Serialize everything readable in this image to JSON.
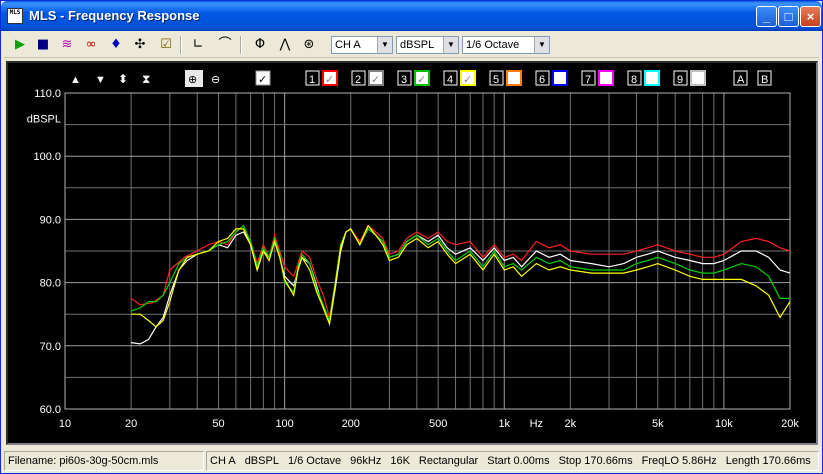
{
  "window": {
    "title": "MLS - Frequency Response",
    "icon_label": "MLS"
  },
  "toolbar": {
    "icons": [
      "run-icon",
      "save-icon",
      "spectrum-icon",
      "infinity-icon",
      "marker-icon",
      "cursor-icon",
      "check-icon",
      "axes-icon",
      "curve-icon",
      "phase-icon",
      "filter-icon",
      "target-icon"
    ],
    "channel": "CH A",
    "unit": "dBSPL",
    "smoothing": "1/6 Octave"
  },
  "plot_toolbar": {
    "overlays": [
      {
        "num": "1",
        "color": "#ff0000",
        "checked": true
      },
      {
        "num": "2",
        "color": "#808080",
        "checked": true
      },
      {
        "num": "3",
        "color": "#00c000",
        "checked": true
      },
      {
        "num": "4",
        "color": "#ffff00",
        "checked": true
      },
      {
        "num": "5",
        "color": "#ff8000",
        "checked": false
      },
      {
        "num": "6",
        "color": "#0000ff",
        "checked": false
      },
      {
        "num": "7",
        "color": "#ff00ff",
        "checked": false
      },
      {
        "num": "8",
        "color": "#00ffff",
        "checked": false
      },
      {
        "num": "9",
        "color": "#c0c0c0",
        "checked": false
      }
    ],
    "extra_buttons": [
      "A",
      "B"
    ]
  },
  "chart_data": {
    "type": "line",
    "ylabel": "dBSPL",
    "xlabel": "Hz",
    "x_scale": "log",
    "xlim": [
      10,
      20000
    ],
    "ylim": [
      60,
      110
    ],
    "y_ticks": [
      "110.0",
      "100.0",
      "90.0",
      "80.0",
      "70.0",
      "60.0"
    ],
    "x_ticks": [
      {
        "v": 10,
        "label": "10"
      },
      {
        "v": 20,
        "label": "20"
      },
      {
        "v": 50,
        "label": "50"
      },
      {
        "v": 100,
        "label": "100"
      },
      {
        "v": 200,
        "label": "200"
      },
      {
        "v": 500,
        "label": "500"
      },
      {
        "v": 1000,
        "label": "1k"
      },
      {
        "v": 2000,
        "label": "2k"
      },
      {
        "v": 5000,
        "label": "5k"
      },
      {
        "v": 10000,
        "label": "10k"
      },
      {
        "v": 20000,
        "label": "20k"
      }
    ],
    "hz_label_freq": 1400,
    "grid": true,
    "series": [
      {
        "color": "#ff2020",
        "points": [
          [
            20,
            77.5
          ],
          [
            22,
            76.5
          ],
          [
            25,
            76.8
          ],
          [
            28,
            78
          ],
          [
            30,
            82
          ],
          [
            35,
            84
          ],
          [
            40,
            85
          ],
          [
            45,
            86
          ],
          [
            50,
            86.5
          ],
          [
            55,
            86
          ],
          [
            60,
            88
          ],
          [
            65,
            89
          ],
          [
            70,
            86.5
          ],
          [
            75,
            83
          ],
          [
            80,
            86
          ],
          [
            85,
            84
          ],
          [
            90,
            87.5
          ],
          [
            95,
            85
          ],
          [
            100,
            82.5
          ],
          [
            110,
            81
          ],
          [
            115,
            83
          ],
          [
            120,
            85
          ],
          [
            130,
            84
          ],
          [
            140,
            80.5
          ],
          [
            150,
            78
          ],
          [
            160,
            74.5
          ],
          [
            170,
            80
          ],
          [
            180,
            86
          ],
          [
            190,
            88
          ],
          [
            200,
            88.5
          ],
          [
            220,
            86.5
          ],
          [
            240,
            89
          ],
          [
            260,
            88
          ],
          [
            280,
            87
          ],
          [
            300,
            84.5
          ],
          [
            330,
            85
          ],
          [
            360,
            87
          ],
          [
            400,
            88
          ],
          [
            450,
            87
          ],
          [
            500,
            88
          ],
          [
            550,
            86.5
          ],
          [
            600,
            86
          ],
          [
            700,
            86.5
          ],
          [
            800,
            84
          ],
          [
            900,
            86
          ],
          [
            1000,
            84
          ],
          [
            1100,
            84.5
          ],
          [
            1200,
            83.5
          ],
          [
            1400,
            86.5
          ],
          [
            1600,
            85.5
          ],
          [
            1800,
            86
          ],
          [
            2000,
            85
          ],
          [
            2500,
            84.5
          ],
          [
            3000,
            84.5
          ],
          [
            3500,
            84.5
          ],
          [
            4000,
            85
          ],
          [
            4500,
            85.5
          ],
          [
            5000,
            86
          ],
          [
            6000,
            85
          ],
          [
            7000,
            84.5
          ],
          [
            8000,
            84
          ],
          [
            9000,
            84
          ],
          [
            10000,
            84.5
          ],
          [
            12000,
            86.5
          ],
          [
            14000,
            87
          ],
          [
            16000,
            86.5
          ],
          [
            18000,
            85.5
          ],
          [
            20000,
            85
          ]
        ]
      },
      {
        "color": "#ffffff",
        "points": [
          [
            20,
            70.5
          ],
          [
            22,
            70.3
          ],
          [
            24,
            71
          ],
          [
            26,
            73
          ],
          [
            28,
            74.5
          ],
          [
            30,
            78
          ],
          [
            33,
            82
          ],
          [
            36,
            83.5
          ],
          [
            40,
            84.5
          ],
          [
            45,
            85
          ],
          [
            50,
            86
          ],
          [
            55,
            85.5
          ],
          [
            60,
            87.5
          ],
          [
            65,
            88
          ],
          [
            70,
            86
          ],
          [
            75,
            82
          ],
          [
            80,
            85
          ],
          [
            85,
            84
          ],
          [
            90,
            86.5
          ],
          [
            95,
            84
          ],
          [
            100,
            81
          ],
          [
            110,
            79.5
          ],
          [
            115,
            82
          ],
          [
            120,
            84
          ],
          [
            130,
            83
          ],
          [
            140,
            79.5
          ],
          [
            150,
            76
          ],
          [
            160,
            73.5
          ],
          [
            170,
            79
          ],
          [
            180,
            85
          ],
          [
            190,
            88
          ],
          [
            200,
            88.5
          ],
          [
            220,
            86
          ],
          [
            240,
            88.5
          ],
          [
            260,
            87.5
          ],
          [
            280,
            86.5
          ],
          [
            300,
            84
          ],
          [
            330,
            84.5
          ],
          [
            360,
            86.5
          ],
          [
            400,
            87.5
          ],
          [
            450,
            86.5
          ],
          [
            500,
            87.5
          ],
          [
            550,
            85.5
          ],
          [
            600,
            84.5
          ],
          [
            700,
            85.5
          ],
          [
            800,
            83.5
          ],
          [
            900,
            85.5
          ],
          [
            1000,
            83.5
          ],
          [
            1100,
            84
          ],
          [
            1200,
            82.5
          ],
          [
            1400,
            85
          ],
          [
            1600,
            84
          ],
          [
            1800,
            84.5
          ],
          [
            2000,
            83.5
          ],
          [
            2500,
            83
          ],
          [
            3000,
            82.5
          ],
          [
            3500,
            83
          ],
          [
            4000,
            84
          ],
          [
            4500,
            84.5
          ],
          [
            5000,
            85
          ],
          [
            6000,
            84
          ],
          [
            7000,
            83.5
          ],
          [
            8000,
            83
          ],
          [
            9000,
            83
          ],
          [
            10000,
            83.5
          ],
          [
            12000,
            85
          ],
          [
            14000,
            85
          ],
          [
            16000,
            84
          ],
          [
            18000,
            82
          ],
          [
            20000,
            81.5
          ]
        ]
      },
      {
        "color": "#00d000",
        "points": [
          [
            20,
            75.5
          ],
          [
            22,
            76
          ],
          [
            24,
            77
          ],
          [
            26,
            77
          ],
          [
            28,
            78
          ],
          [
            30,
            80
          ],
          [
            33,
            83
          ],
          [
            36,
            84
          ],
          [
            40,
            84.5
          ],
          [
            45,
            85
          ],
          [
            50,
            86
          ],
          [
            55,
            86.5
          ],
          [
            60,
            88
          ],
          [
            65,
            89
          ],
          [
            70,
            86.5
          ],
          [
            75,
            82.5
          ],
          [
            80,
            85.5
          ],
          [
            85,
            84
          ],
          [
            90,
            87
          ],
          [
            95,
            84.5
          ],
          [
            100,
            80
          ],
          [
            110,
            78.5
          ],
          [
            115,
            82.5
          ],
          [
            120,
            84.5
          ],
          [
            130,
            83
          ],
          [
            140,
            79
          ],
          [
            150,
            76.5
          ],
          [
            160,
            74
          ],
          [
            170,
            80
          ],
          [
            180,
            86
          ],
          [
            190,
            88
          ],
          [
            200,
            88.5
          ],
          [
            220,
            86
          ],
          [
            240,
            88.5
          ],
          [
            260,
            87.5
          ],
          [
            280,
            86.5
          ],
          [
            300,
            84
          ],
          [
            330,
            84.5
          ],
          [
            360,
            86.5
          ],
          [
            400,
            87.5
          ],
          [
            450,
            86
          ],
          [
            500,
            87
          ],
          [
            550,
            85
          ],
          [
            600,
            83.5
          ],
          [
            700,
            85
          ],
          [
            800,
            82.5
          ],
          [
            900,
            85
          ],
          [
            1000,
            82.5
          ],
          [
            1100,
            83
          ],
          [
            1200,
            82
          ],
          [
            1400,
            84
          ],
          [
            1600,
            83
          ],
          [
            1800,
            83.5
          ],
          [
            2000,
            82.5
          ],
          [
            2500,
            82
          ],
          [
            3000,
            82
          ],
          [
            3500,
            82
          ],
          [
            4000,
            83
          ],
          [
            4500,
            83.5
          ],
          [
            5000,
            84
          ],
          [
            6000,
            83
          ],
          [
            7000,
            82
          ],
          [
            8000,
            81.5
          ],
          [
            9000,
            81.5
          ],
          [
            10000,
            82
          ],
          [
            12000,
            83
          ],
          [
            14000,
            82.5
          ],
          [
            16000,
            81
          ],
          [
            18000,
            77.5
          ],
          [
            20000,
            77.5
          ]
        ]
      },
      {
        "color": "#ffff00",
        "points": [
          [
            20,
            75
          ],
          [
            22,
            75
          ],
          [
            24,
            74
          ],
          [
            26,
            73
          ],
          [
            28,
            74
          ],
          [
            30,
            77
          ],
          [
            33,
            82
          ],
          [
            36,
            84
          ],
          [
            40,
            84.5
          ],
          [
            45,
            85
          ],
          [
            50,
            86.5
          ],
          [
            55,
            87
          ],
          [
            60,
            88.5
          ],
          [
            65,
            88.5
          ],
          [
            70,
            86
          ],
          [
            75,
            82
          ],
          [
            80,
            85
          ],
          [
            85,
            83.5
          ],
          [
            90,
            86.5
          ],
          [
            95,
            84
          ],
          [
            100,
            80.5
          ],
          [
            110,
            78
          ],
          [
            115,
            82
          ],
          [
            120,
            84
          ],
          [
            130,
            82
          ],
          [
            140,
            78.5
          ],
          [
            150,
            76
          ],
          [
            160,
            73.5
          ],
          [
            170,
            79.5
          ],
          [
            180,
            85.5
          ],
          [
            190,
            88
          ],
          [
            200,
            88.5
          ],
          [
            220,
            86
          ],
          [
            240,
            89
          ],
          [
            260,
            87.5
          ],
          [
            280,
            86
          ],
          [
            300,
            83.5
          ],
          [
            330,
            84
          ],
          [
            360,
            86
          ],
          [
            400,
            87
          ],
          [
            450,
            85.5
          ],
          [
            500,
            86.5
          ],
          [
            550,
            84.5
          ],
          [
            600,
            83
          ],
          [
            700,
            84.5
          ],
          [
            800,
            82
          ],
          [
            900,
            84.5
          ],
          [
            1000,
            82
          ],
          [
            1100,
            82.5
          ],
          [
            1200,
            81
          ],
          [
            1400,
            83
          ],
          [
            1600,
            82
          ],
          [
            1800,
            82.5
          ],
          [
            2000,
            82
          ],
          [
            2500,
            81.5
          ],
          [
            3000,
            81.5
          ],
          [
            3500,
            81.5
          ],
          [
            4000,
            82
          ],
          [
            4500,
            82.5
          ],
          [
            5000,
            83
          ],
          [
            6000,
            82
          ],
          [
            7000,
            81
          ],
          [
            8000,
            80.5
          ],
          [
            9000,
            80.5
          ],
          [
            10000,
            80.5
          ],
          [
            12000,
            80.5
          ],
          [
            14000,
            79.5
          ],
          [
            16000,
            78
          ],
          [
            18000,
            74.5
          ],
          [
            20000,
            77
          ]
        ]
      }
    ]
  },
  "status": {
    "filename": "Filename: pi60s-30g-50cm.mls",
    "items": [
      "CH A",
      "dBSPL",
      "1/6 Octave",
      "96kHz",
      "16K",
      "Rectangular",
      "Start 0.00ms",
      "Stop 170.66ms",
      "FreqLO 5.86Hz",
      "Length 170.66ms"
    ]
  }
}
